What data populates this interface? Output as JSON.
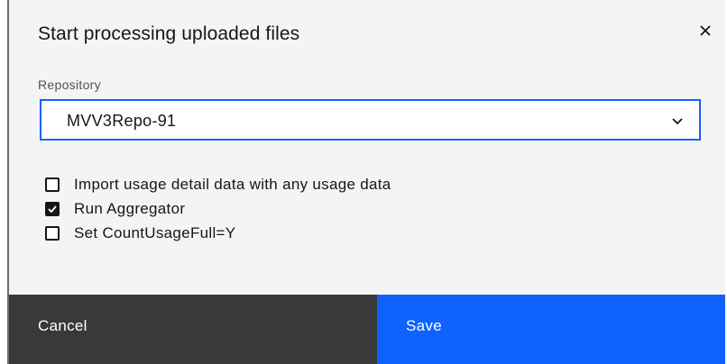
{
  "modal": {
    "title": "Start processing uploaded files",
    "close_icon": "close-icon"
  },
  "repository": {
    "label": "Repository",
    "selected": "MVV3Repo-91",
    "chevron_icon": "chevron-down-icon"
  },
  "options": [
    {
      "label": "Import usage detail data with any usage data",
      "checked": false
    },
    {
      "label": "Run Aggregator",
      "checked": true
    },
    {
      "label": "Set CountUsageFull=Y",
      "checked": false
    }
  ],
  "footer": {
    "cancel_label": "Cancel",
    "save_label": "Save"
  },
  "colors": {
    "primary": "#0f62fe",
    "secondary": "#393939",
    "background": "#f4f4f4"
  }
}
